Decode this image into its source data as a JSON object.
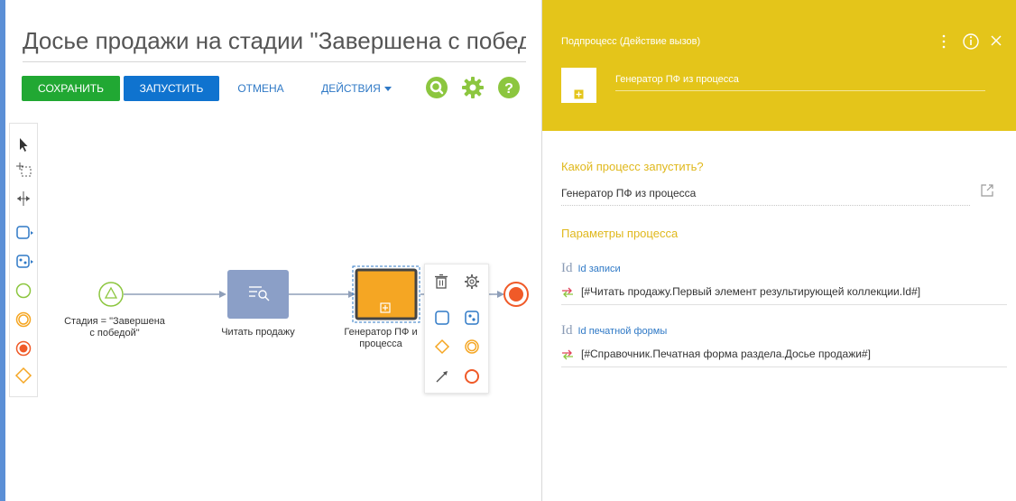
{
  "page_title": "Досье продажи на стадии \"Завершена с побед",
  "toolbar": {
    "save_label": "СОХРАНИТЬ",
    "run_label": "ЗАПУСТИТЬ",
    "cancel_label": "ОТМЕНА",
    "actions_label": "ДЕЙСТВИЯ"
  },
  "icons": {
    "search": "search-icon",
    "settings": "gear-icon",
    "help": "help-icon"
  },
  "toolbox_items": [
    "pointer-tool",
    "lasso-select-tool",
    "space-tool",
    "task-tool",
    "subprocess-tool",
    "start-event-tool",
    "intermediate-event-tool",
    "end-event-tool",
    "gateway-tool"
  ],
  "diagram": {
    "start_label_1": "Стадия = \"Завершена",
    "start_label_2": "с победой\"",
    "read_label": "Читать продажу",
    "gen_label_1": "Генератор ПФ и",
    "gen_label_2": "процесса"
  },
  "panel": {
    "header_title": "Подпроцесс (Действие вызов)",
    "element_name": "Генератор ПФ из процесса",
    "which_process_label": "Какой процесс запустить?",
    "which_process_value": "Генератор ПФ из процесса",
    "params_label": "Параметры процесса",
    "id_glyph": "Id",
    "params": [
      {
        "title": "Id записи",
        "value": "[#Читать продажу.Первый элемент результирующей коллекции.Id#]"
      },
      {
        "title": "Id печатной формы",
        "value": "[#Справочник.Печатная форма раздела.Досье продажи#]"
      }
    ]
  },
  "colors": {
    "save": "#21a833",
    "run": "#0f73cf",
    "accent_link": "#2f79c6",
    "header": "#e4c51a",
    "round_icon": "#8cc63f",
    "task": "#8b9fc7",
    "subprocess": "#f5a623",
    "end": "#f05a28"
  }
}
